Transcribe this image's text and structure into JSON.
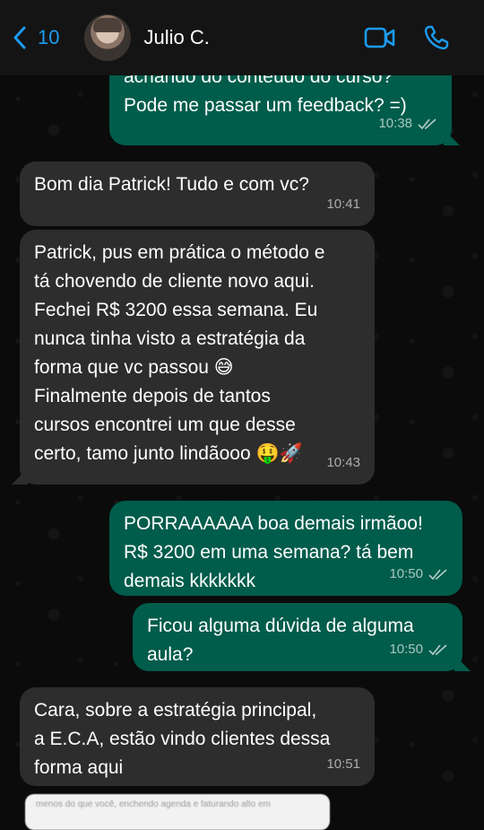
{
  "header": {
    "back_count": "10",
    "contact_name": "Julio C.",
    "icons": {
      "back": "chevron-left-icon",
      "video": "video-camera-icon",
      "call": "phone-icon"
    },
    "accent_color": "#1c9bf0"
  },
  "messages": [
    {
      "direction": "out",
      "text": "achando do conteúdo do curso?\nPode me passar um feedback? =)",
      "time": "10:38",
      "read": true
    },
    {
      "direction": "in",
      "text": "Bom dia Patrick! Tudo e com vc?",
      "time": "10:41"
    },
    {
      "direction": "in",
      "text": "Patrick, pus em prática o método e\ntá chovendo de cliente novo aqui.\nFechei R$ 3200 essa semana. Eu\nnunca tinha visto a estratégia da\nforma que vc passou 😅\nFinalmente depois de tantos\ncursos encontrei um que desse\ncerto, tamo junto lindãooo 🤑🚀",
      "time": "10:43"
    },
    {
      "direction": "out",
      "text": "PORRAAAAAA boa demais irmãoo!\nR$ 3200 em uma semana? tá bem\ndemais kkkkkkk",
      "time": "10:50",
      "read": true
    },
    {
      "direction": "out",
      "text": "Ficou alguma dúvida de alguma\naula?",
      "time": "10:50",
      "read": true
    },
    {
      "direction": "in",
      "text": "Cara, sobre a estratégia principal,\na E.C.A, estão vindo clientes dessa\nforma aqui",
      "time": "10:51"
    }
  ],
  "preview_snippet": "menos do que você, enchendo agenda e faturando alto em",
  "colors": {
    "incoming_bubble": "#2d2d2d",
    "outgoing_bubble": "#005c4b",
    "background": "#0b0b0b"
  }
}
